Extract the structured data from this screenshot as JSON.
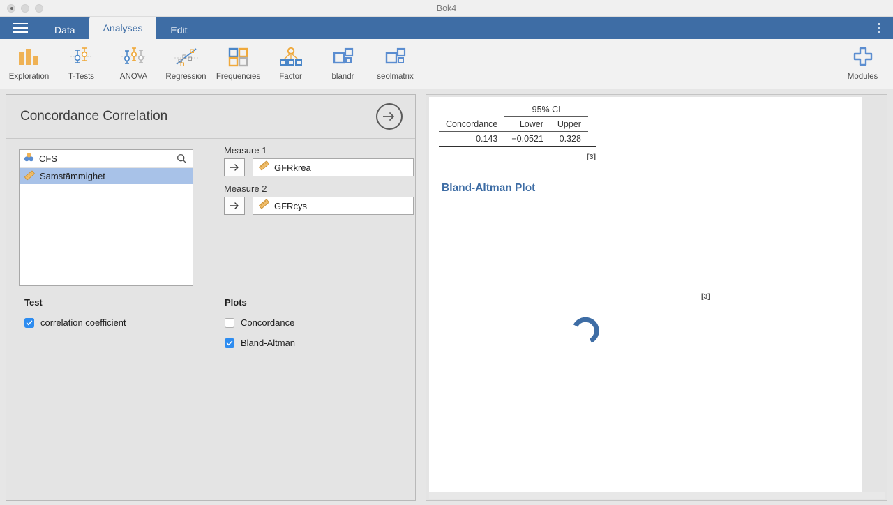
{
  "window": {
    "title": "Bok4",
    "traffic_lights": [
      "close-button",
      "minimize-button",
      "zoom-button"
    ]
  },
  "tabbar": {
    "menu_icon": "hamburger-icon",
    "kebab_icon": "more-options-icon",
    "tabs": [
      {
        "label": "Data",
        "active": false
      },
      {
        "label": "Analyses",
        "active": true
      },
      {
        "label": "Edit",
        "active": false
      }
    ]
  },
  "ribbon": {
    "items": [
      {
        "label": "Exploration",
        "icon": "bar-chart-icon"
      },
      {
        "label": "T-Tests",
        "icon": "t-tests-icon"
      },
      {
        "label": "ANOVA",
        "icon": "anova-icon"
      },
      {
        "label": "Regression",
        "icon": "scatter-regression-icon"
      },
      {
        "label": "Frequencies",
        "icon": "frequencies-grid-icon"
      },
      {
        "label": "Factor",
        "icon": "factor-tree-icon"
      },
      {
        "label": "blandr",
        "icon": "module-squares-icon"
      },
      {
        "label": "seolmatrix",
        "icon": "module-squares-icon"
      }
    ],
    "modules": {
      "label": "Modules",
      "icon": "plus-cross-icon"
    }
  },
  "options": {
    "title": "Concordance Correlation",
    "forward_arrow_icon": "arrow-right-circle-icon",
    "variable_list": {
      "search_icon": "search-icon",
      "search_value": "CFS",
      "search_value_icon": "nominal-variable-icon",
      "items": [
        {
          "label": "Samstämmighet",
          "icon": "continuous-variable-icon",
          "selected": true
        }
      ]
    },
    "measure1": {
      "label": "Measure 1",
      "assign_icon": "arrow-right-icon",
      "value": "GFRkrea",
      "value_icon": "continuous-variable-icon"
    },
    "measure2": {
      "label": "Measure 2",
      "assign_icon": "arrow-right-icon",
      "value": "GFRcys",
      "value_icon": "continuous-variable-icon"
    },
    "test_group": {
      "title": "Test",
      "items": [
        {
          "label": "correlation coefficient",
          "checked": true
        }
      ]
    },
    "plots_group": {
      "title": "Plots",
      "items": [
        {
          "label": "Concordance",
          "checked": false
        },
        {
          "label": "Bland-Altman",
          "checked": true
        }
      ]
    }
  },
  "results": {
    "table": {
      "span_header": "95% CI",
      "headers": [
        "Concordance",
        "Lower",
        "Upper"
      ],
      "rows": [
        [
          "0.143",
          "−0.0521",
          "0.328"
        ]
      ],
      "note": "[3]"
    },
    "plot": {
      "title": "Bland-Altman Plot",
      "note": "[3]",
      "status_icon": "loading-spinner-icon"
    }
  }
}
